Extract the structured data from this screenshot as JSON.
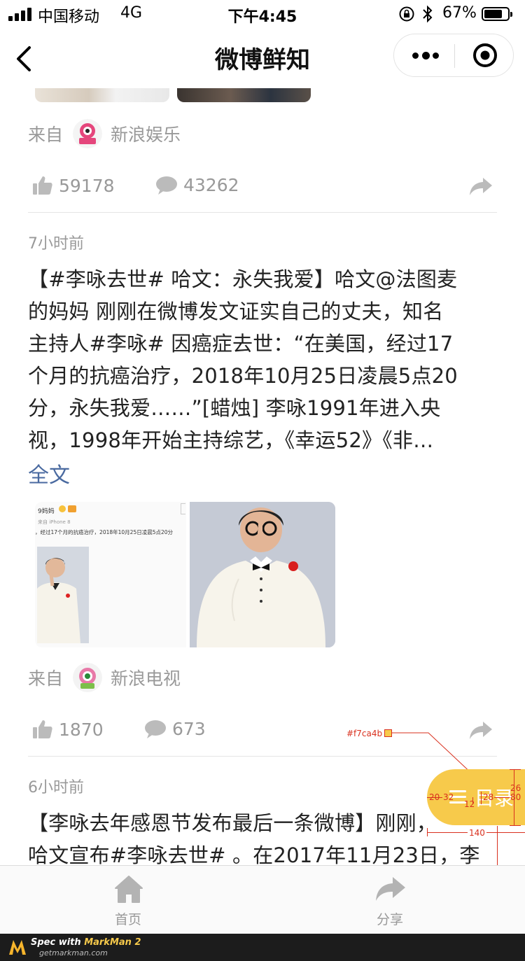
{
  "status_bar": {
    "carrier": "中国移动",
    "network": "4G",
    "time": "下午4:45",
    "battery": "67%"
  },
  "nav": {
    "title": "微博鲜知"
  },
  "posts": [
    {
      "source_prefix": "来自",
      "source_name": "新浪娱乐",
      "likes": "59178",
      "comments": "43262"
    },
    {
      "time": "7小时前",
      "text_lines": [
        "【#李咏去世# 哈文：永失我爱】哈文@法图麦",
        "的妈妈 刚刚在微博发文证实自己的丈夫，知名",
        "主持人#李咏# 因癌症去世：“在美国，经过17",
        "个月的抗癌治疗，2018年10月25日凌晨5点20",
        "分，永失我爱……”[蜡烛] 李咏1991年进入央",
        "视，1998年开始主持综艺，《幸运52》《非…"
      ],
      "full_text_link": "全文",
      "screenshot_image": {
        "name": "9妈妈",
        "device": "来自 iPhone 8",
        "caption": "，经过17个月的抗癌治疗，2018年10月25日凌晨5点20分"
      },
      "source_prefix": "来自",
      "source_name": "新浪电视",
      "likes": "1870",
      "comments": "673"
    },
    {
      "time": "6小时前",
      "text_lines": [
        "【李咏去年感恩节发布最后一条微博】刚刚，",
        "哈文宣布#李咏去世# 。在2017年11月23日，李"
      ]
    }
  ],
  "floating_button": {
    "label": "目录",
    "color": "#f7ca4b"
  },
  "spec_annotations": {
    "color_label": "#f7ca4b",
    "left_padding": "20",
    "icon_width": "32",
    "gap": "12",
    "text_offset": "28",
    "top_offset": "26",
    "height": "80",
    "width": "140",
    "bottom_offset": "154"
  },
  "tab_bar": {
    "home": "首页",
    "share": "分享"
  },
  "watermark": {
    "line1_prefix": "Spec with ",
    "line1_brand": "MarkMan 2",
    "line2": "getmarkman.com"
  }
}
